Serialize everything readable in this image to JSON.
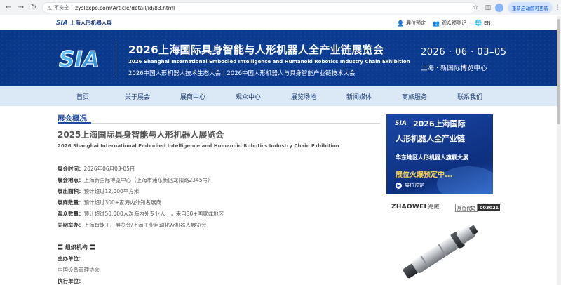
{
  "browser": {
    "insecure_label": "不安全",
    "url": "zyslexpo.com/Article/detail/id/83.html",
    "restart_label": "重新启动即可更新",
    "icons": [
      "back-icon",
      "forward-icon",
      "reload-icon",
      "info-icon",
      "star-icon",
      "sidebar-icon",
      "profile-icon",
      "kebab-icon"
    ]
  },
  "topbar": {
    "brand_mark": "SIA",
    "brand_text": "上海人形机器人展",
    "exhibit_booking": "展位预定",
    "visitor_register": "观众预登记",
    "language": "EN"
  },
  "banner": {
    "logo_text": "SIA",
    "title": "2026上海国际具身智能与人形机器人全产业链展览会",
    "subtitle_en": "2026 Shanghai International Embodied Intelligence and Humanoid Robotics Industry Chain Exhibition",
    "subtitle_conf": "2026中国人形机器人技术生态大会  |  2026中国人形机器人与具身智能产业链技术大会",
    "date": "2026 · 06 · 03–05",
    "venue": "上海 · 新国际博览中心"
  },
  "nav": {
    "items": [
      "首页",
      "关于展会",
      "展商中心",
      "观众中心",
      "展览场地",
      "新闻媒体",
      "商旅服务",
      "联系我们"
    ]
  },
  "article": {
    "section_title": "展会概况",
    "title": "2025上海国际具身智能与人形机器人展览会",
    "title_en": "2026 Shanghai International Embodied Intelligence and Humanoid Robotics Industry Chain Exhibition",
    "details": [
      {
        "key": "展会时间：",
        "value": "2026年06月03-05日"
      },
      {
        "key": "展会地点：",
        "value": "上海新国际博览中心（上海市浦东新区龙阳路2345号）"
      },
      {
        "key": "展出面积：",
        "value": "预计超过12,000平方米"
      },
      {
        "key": "展商数量：",
        "value": "预计超过300+家海内外知名展商"
      },
      {
        "key": "观众数量：",
        "value": "预计超过50,000人次海内外专业人士，来自30+国家或地区"
      },
      {
        "key": "同期举办：",
        "value": "上海智能工厂展览会/上海工业自动化及机器人展览会"
      }
    ],
    "org_heading": "〓 组织机构 〓",
    "org_host_label": "主办单位：",
    "org_host_value": "中国设备管理协会",
    "org_exec_label": "执行单位："
  },
  "ad": {
    "logo": "SIA",
    "line1": "2026上海国际",
    "line2": "人形机器人全产业链",
    "line3": "华东地区人形机器人旗舰大展",
    "line4": "展位火爆预定中...",
    "button": "展位预定",
    "accent": "#ffd34d"
  },
  "exhibitor": {
    "brand": "ZHAOWEI",
    "brand_cn": "兆威",
    "booth_label": "展位代码",
    "booth_code": "003021"
  },
  "colors": {
    "banner": "#0b3a8e",
    "nav_bg": "#dbe9f7",
    "accent_blue": "#1d4aa0"
  }
}
